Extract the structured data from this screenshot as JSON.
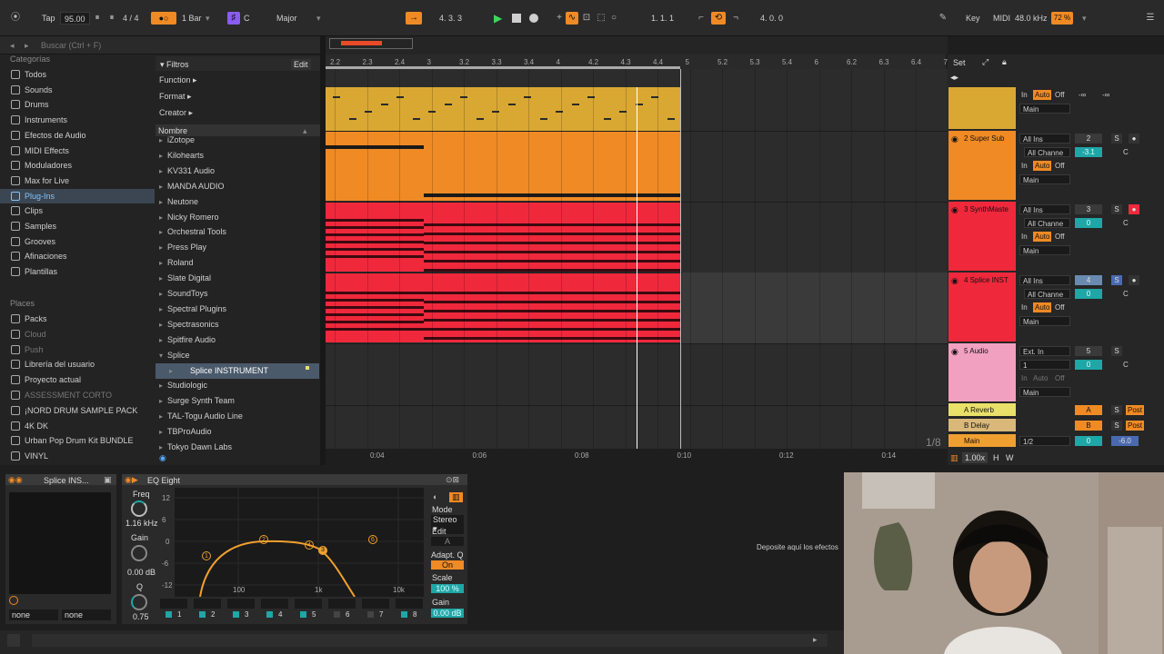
{
  "transport": {
    "tap": "Tap",
    "tempo": "95.00",
    "signature": "4 / 4",
    "loop_length": "1 Bar",
    "key": "C",
    "scale": "Major",
    "position": "4.  3.  3",
    "loop_start": "1.  1.  1",
    "loop_length_pos": "4.  0.  0",
    "key_label": "Key",
    "midi_label": "MIDI",
    "sample_rate": "48.0 kHz",
    "cpu": "72 %"
  },
  "browser": {
    "search_placeholder": "Buscar (Ctrl + F)",
    "categories_header": "Categorías",
    "categories": [
      {
        "label": "Todos"
      },
      {
        "label": "Sounds"
      },
      {
        "label": "Drums"
      },
      {
        "label": "Instruments"
      },
      {
        "label": "Efectos de Audio"
      },
      {
        "label": "MIDI Effects"
      },
      {
        "label": "Moduladores"
      },
      {
        "label": "Max for Live"
      },
      {
        "label": "Plug-Ins"
      },
      {
        "label": "Clips"
      },
      {
        "label": "Samples"
      },
      {
        "label": "Grooves"
      },
      {
        "label": "Afinaciones"
      },
      {
        "label": "Plantillas"
      }
    ],
    "places_header": "Places",
    "places": [
      {
        "label": "Packs"
      },
      {
        "label": "Cloud"
      },
      {
        "label": "Push"
      },
      {
        "label": "Librería del usuario"
      },
      {
        "label": "Proyecto actual"
      },
      {
        "label": "ASSESSMENT CORTO"
      },
      {
        "label": "¡NORD DRUM SAMPLE PACK"
      },
      {
        "label": "4K DK"
      },
      {
        "label": "Urban Pop Drum Kit BUNDLE"
      },
      {
        "label": "VINYL"
      }
    ],
    "filters_label": "Filtros",
    "edit_label": "Edit",
    "filters": [
      {
        "label": "Function ▸"
      },
      {
        "label": "Format ▸"
      },
      {
        "label": "Creator ▸"
      }
    ],
    "name_header": "Nombre",
    "items": [
      {
        "label": "iZotope"
      },
      {
        "label": "Kilohearts"
      },
      {
        "label": "KV331 Audio"
      },
      {
        "label": "MANDA AUDIO"
      },
      {
        "label": "Neutone"
      },
      {
        "label": "Nicky Romero"
      },
      {
        "label": "Orchestral Tools"
      },
      {
        "label": "Press Play"
      },
      {
        "label": "Roland"
      },
      {
        "label": "Slate Digital"
      },
      {
        "label": "SoundToys"
      },
      {
        "label": "Spectral Plugins"
      },
      {
        "label": "Spectrasonics"
      },
      {
        "label": "Spitfire Audio"
      },
      {
        "label": "Splice"
      },
      {
        "label": "Splice INSTRUMENT"
      },
      {
        "label": "Studiologic"
      },
      {
        "label": "Surge Synth Team"
      },
      {
        "label": "TAL-Togu Audio Line"
      },
      {
        "label": "TBProAudio"
      },
      {
        "label": "Tokyo Dawn Labs"
      }
    ]
  },
  "arrangement": {
    "bar_ticks": [
      "2.2",
      "2.3",
      "2.4",
      "3",
      "3.2",
      "3.3",
      "3.4",
      "4",
      "4.2",
      "4.3",
      "4.4",
      "5",
      "5.2",
      "5.3",
      "5.4",
      "6",
      "6.2",
      "6.3",
      "6.4",
      "7"
    ],
    "time_ticks": [
      "0:04",
      "0:06",
      "0:08",
      "0:10",
      "0:12",
      "0:14"
    ],
    "set_label": "Set",
    "grid_label": "1/8"
  },
  "tracks": [
    {
      "name": "",
      "color": "#d9a833",
      "input": "In",
      "auto": "Auto",
      "off": "Off",
      "out": "Main",
      "vol": "-∞",
      "pan": "-∞"
    },
    {
      "name": "2 Super Sub",
      "color": "#f08a24",
      "input": "All Ins",
      "channel": "All Channe",
      "out": "Main",
      "num": "2",
      "vol": "-3.1",
      "pan": "C"
    },
    {
      "name": "3 SynthMaste",
      "color": "#f0283c",
      "input": "All Ins",
      "channel": "All Channe",
      "out": "Main",
      "num": "3",
      "vol": "0",
      "pan": "C"
    },
    {
      "name": "4 Splice INST",
      "color": "#f0283c",
      "input": "All Ins",
      "channel": "All Channe",
      "out": "Main",
      "num": "4",
      "vol": "0",
      "pan": "C"
    },
    {
      "name": "5 Audio",
      "color": "#f2a0c0",
      "input": "Ext. In",
      "channel": "1",
      "out": "Main",
      "num": "5",
      "vol": "0",
      "pan": "C"
    }
  ],
  "returns": [
    {
      "name": "A Reverb",
      "color": "#e9e06a",
      "send": "A",
      "post": "Post"
    },
    {
      "name": "B Delay",
      "color": "#d9b87a",
      "send": "B",
      "post": "Post"
    },
    {
      "name": "Main",
      "color": "#f0a030",
      "out": "1/2",
      "vol": "0",
      "pan": "-6.0"
    }
  ],
  "master": {
    "zoom": "1.00x",
    "h": "H",
    "w": "W"
  },
  "devices": {
    "instrument_name": "Splice INS...",
    "instrument_in": "none",
    "instrument_out": "none",
    "eq_name": "EQ Eight",
    "freq_label": "Freq",
    "freq_value": "1.16 kHz",
    "gain_label": "Gain",
    "gain_value": "0.00 dB",
    "q_label": "Q",
    "q_value": "0.75",
    "db_ticks": [
      "12",
      "6",
      "0",
      "-6",
      "-12"
    ],
    "freq_ticks": [
      "100",
      "1k",
      "10k"
    ],
    "mode_label": "Mode",
    "mode_value": "Stereo ▾",
    "edit_label": "Edit",
    "edit_value": "A",
    "adaptq_label": "Adapt. Q",
    "adaptq_value": "On",
    "scale_label": "Scale",
    "scale_value": "100 %",
    "out_gain_label": "Gain",
    "out_gain_value": "0.00 dB",
    "bands": [
      "1",
      "2",
      "3",
      "4",
      "5",
      "6",
      "7",
      "8"
    ],
    "drop_text": "Deposite aquí los efectos"
  }
}
